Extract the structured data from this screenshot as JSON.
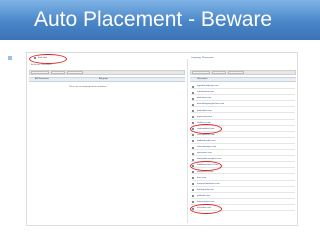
{
  "slide": {
    "title": "Auto Placement - Beware"
  },
  "left_panel": {
    "header_text": "Excluded",
    "sub_text": "Ad group: Placement",
    "column_a": "Ad Placement",
    "column_b": "Ad group",
    "empty_message": "There are no ad group level exclusions"
  },
  "right_panel": {
    "header_text": "Campaign: Placements",
    "column_a": "Placement"
  },
  "placements": [
    {
      "label": "appadvertidesign.com",
      "flagged": false
    },
    {
      "label": "aureliaraken.com",
      "flagged": false
    },
    {
      "label": "beaniums.com",
      "flagged": false
    },
    {
      "label": "beautifulagencyfashion.com",
      "flagged": false
    },
    {
      "label": "bookeditor.com",
      "flagged": false
    },
    {
      "label": "buyinsurity.com",
      "flagged": false
    },
    {
      "label": "chatfreex.com",
      "flagged": false
    },
    {
      "label": "cookanddeal.com",
      "flagged": true
    },
    {
      "label": "cratesparkles.com",
      "flagged": false
    },
    {
      "label": "dadbodseattle.com",
      "flagged": false
    },
    {
      "label": "elitesnakeeyes.com",
      "flagged": false
    },
    {
      "label": "epicrooms.com",
      "flagged": false
    },
    {
      "label": "familyindiscountplus.com",
      "flagged": false
    },
    {
      "label": "foodbloomfitness.com",
      "flagged": true
    },
    {
      "label": "freeguesser.com",
      "flagged": false
    },
    {
      "label": "freer.com",
      "flagged": false
    },
    {
      "label": "freequitclaimforms.com",
      "flagged": false
    },
    {
      "label": "freetaxpedia.com",
      "flagged": false
    },
    {
      "label": "giftfinder.com",
      "flagged": false
    },
    {
      "label": "homeconnex.com",
      "flagged": false
    },
    {
      "label": "oceanlive.com",
      "flagged": true
    }
  ],
  "colors": {
    "banner_top": "#7fb3e6",
    "banner_bottom": "#3a73b6",
    "highlight": "#e02020"
  },
  "icons": {
    "bullet": "square-bullet-icon",
    "checkbox": "checkbox-icon"
  }
}
